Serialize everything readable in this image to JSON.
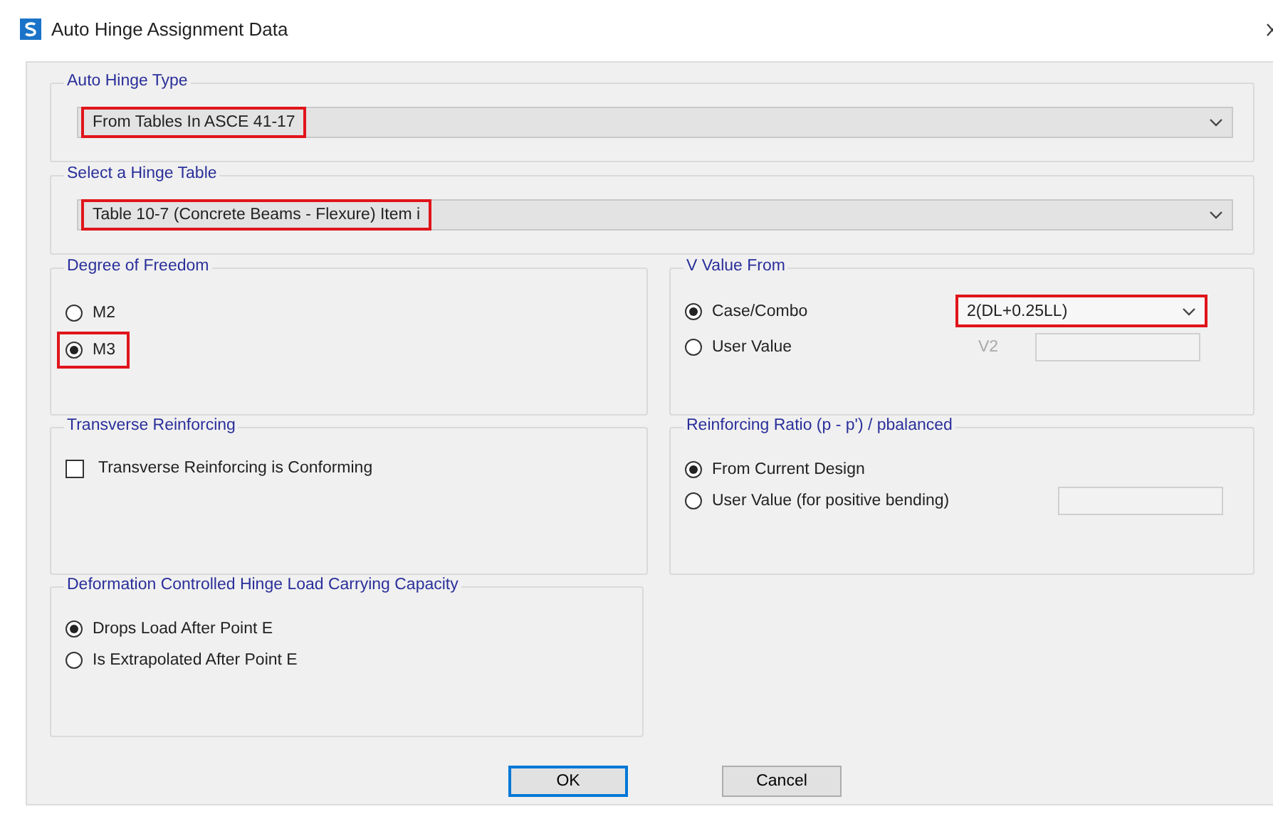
{
  "window": {
    "title": "Auto Hinge Assignment Data"
  },
  "auto_hinge_type": {
    "label": "Auto Hinge Type",
    "value": "From Tables In ASCE 41-17",
    "highlighted": true
  },
  "hinge_table": {
    "label": "Select a Hinge Table",
    "value": "Table 10-7 (Concrete Beams - Flexure) Item i",
    "highlighted": true
  },
  "degree_of_freedom": {
    "label": "Degree of Freedom",
    "options": [
      {
        "label": "M2",
        "selected": false,
        "highlighted": false
      },
      {
        "label": "M3",
        "selected": true,
        "highlighted": true
      }
    ]
  },
  "v_value_from": {
    "label": "V Value From",
    "options": [
      {
        "label": "Case/Combo",
        "selected": true
      },
      {
        "label": "User Value",
        "selected": false
      }
    ],
    "combo": {
      "value": "2(DL+0.25LL)",
      "highlighted": true
    },
    "user_value_field": {
      "label": "V2",
      "disabled": true
    }
  },
  "transverse_reinforcing": {
    "label": "Transverse Reinforcing",
    "checkbox": {
      "label": "Transverse Reinforcing is Conforming",
      "checked": false
    }
  },
  "reinforcing_ratio": {
    "label": "Reinforcing Ratio  (p - p') / pbalanced",
    "options": [
      {
        "label": "From Current Design",
        "selected": true
      },
      {
        "label": "User Value (for positive bending)",
        "selected": false
      }
    ]
  },
  "capacity": {
    "label": "Deformation Controlled Hinge Load Carrying Capacity",
    "options": [
      {
        "label": "Drops Load After Point E",
        "selected": true
      },
      {
        "label": "Is Extrapolated After Point E",
        "selected": false
      }
    ]
  },
  "buttons": [
    {
      "label": "OK",
      "default": true
    },
    {
      "label": "Cancel",
      "default": false
    }
  ]
}
